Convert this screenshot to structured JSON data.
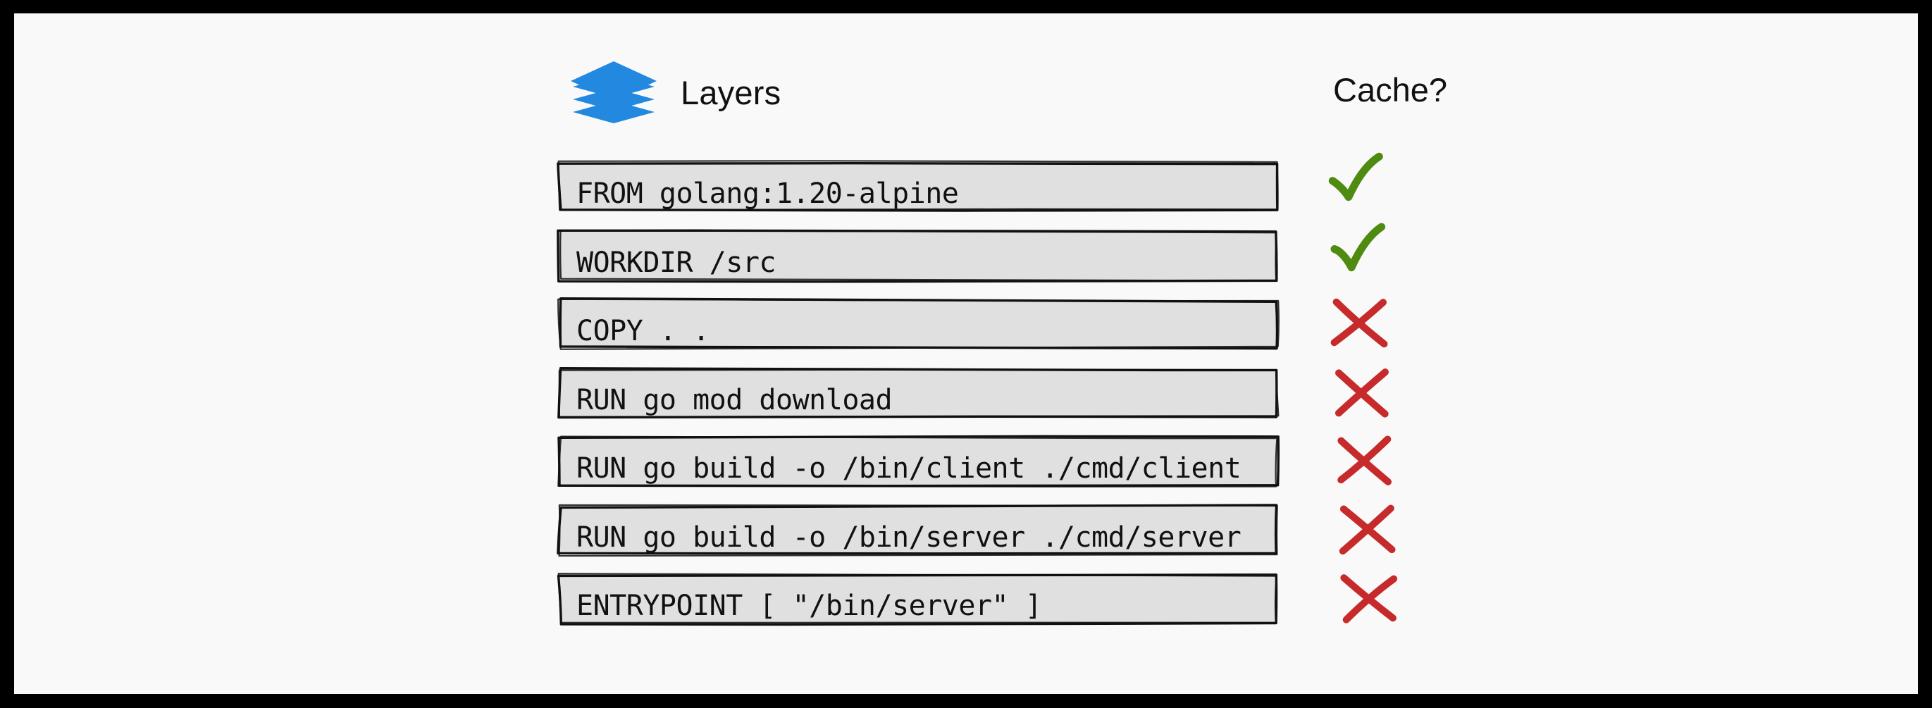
{
  "canvas": {
    "background": "#f9f9f9",
    "border_color": "#000000",
    "box_fill": "#e0e0e0",
    "box_stroke": "#111111",
    "accent_blue": "#2288e0",
    "check_green": "#4e8b10",
    "cross_red": "#c62a2a"
  },
  "header": {
    "layers_icon": "layers-stack-icon",
    "layers_label": "Layers",
    "cache_label": "Cache?"
  },
  "layers": [
    {
      "index": 1,
      "instruction": "FROM golang:1.20-alpine",
      "cached": true,
      "cache_mark": "check-icon",
      "mark_color": "#4e8b10"
    },
    {
      "index": 2,
      "instruction": "WORKDIR /src",
      "cached": true,
      "cache_mark": "check-icon",
      "mark_color": "#4e8b10"
    },
    {
      "index": 3,
      "instruction": "COPY . .",
      "cached": false,
      "cache_mark": "cross-icon",
      "mark_color": "#c62a2a"
    },
    {
      "index": 4,
      "instruction": "RUN go mod download",
      "cached": false,
      "cache_mark": "cross-icon",
      "mark_color": "#c62a2a"
    },
    {
      "index": 5,
      "instruction": "RUN go build -o /bin/client ./cmd/client",
      "cached": false,
      "cache_mark": "cross-icon",
      "mark_color": "#c62a2a"
    },
    {
      "index": 6,
      "instruction": "RUN go build -o /bin/server ./cmd/server",
      "cached": false,
      "cache_mark": "cross-icon",
      "mark_color": "#c62a2a"
    },
    {
      "index": 7,
      "instruction": "ENTRYPOINT [ \"/bin/server\" ]",
      "cached": false,
      "cache_mark": "cross-icon",
      "mark_color": "#c62a2a"
    }
  ]
}
